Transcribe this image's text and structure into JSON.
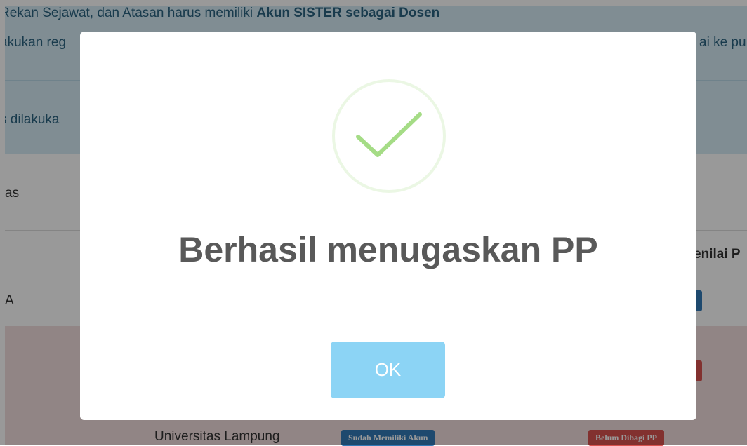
{
  "background_page": {
    "info_notice": {
      "line1_prefix": "Rekan Sejawat, dan Atasan harus memiliki ",
      "line1_bold": "Akun SISTER sebagai Dosen",
      "line2_left": "akukan reg",
      "line2_right": "ai ke pu",
      "line3_left": "s dilakuka"
    },
    "section_label": "as",
    "table_header_right": "enilai P",
    "row1_label": "A",
    "row_last": {
      "university": "Universitas Lampung",
      "account_badge": "Sudah Memiliki Akun",
      "status_badge": "Belum Dibagi PP"
    },
    "colors": {
      "info_bg": "#d6ebf5",
      "danger_row_bg": "#f2dede",
      "primary_badge": "#337ab7",
      "danger_badge": "#d9534f"
    }
  },
  "modal": {
    "icon": "success-check-icon",
    "title": "Berhasil menugaskan PP",
    "ok_label": "OK",
    "ok_color": "#8cd4f5",
    "check_color": "#a5dc86"
  }
}
